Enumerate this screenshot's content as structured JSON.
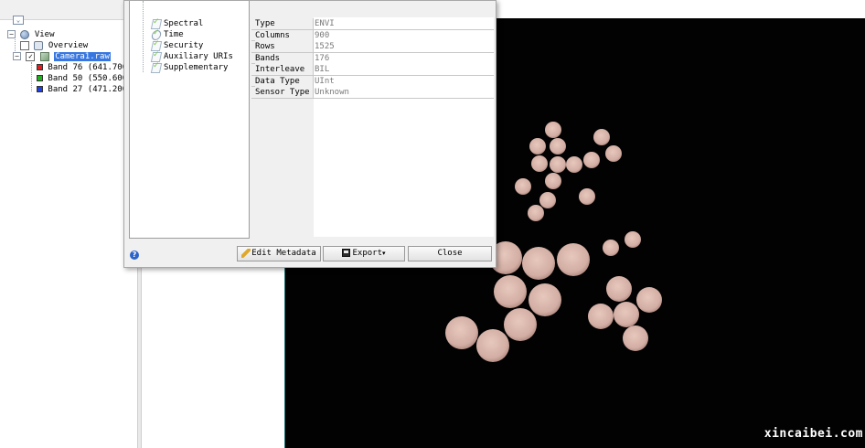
{
  "layer_manager": {
    "root_label": "View",
    "overview_label": "Overview",
    "file_label": "Camera1.raw",
    "bands": [
      {
        "label": "Band 76 (641.700",
        "color": "#e02020"
      },
      {
        "label": "Band 50 (550.600",
        "color": "#20b020"
      },
      {
        "label": "Band 27 (471.200",
        "color": "#2040e0"
      }
    ]
  },
  "metadata_dialog": {
    "categories": [
      {
        "label": "Spectral",
        "icon": "spectral-icon"
      },
      {
        "label": "Time",
        "icon": "clock-icon"
      },
      {
        "label": "Security",
        "icon": "check-icon"
      },
      {
        "label": "Auxiliary URIs",
        "icon": "check-icon"
      },
      {
        "label": "Supplementary",
        "icon": "check-icon"
      }
    ],
    "properties": [
      {
        "key": "Type",
        "value": "ENVI"
      },
      {
        "key": "Columns",
        "value": "900"
      },
      {
        "key": "Rows",
        "value": "1525"
      },
      {
        "key": "Bands",
        "value": "176"
      },
      {
        "key": "Interleave",
        "value": "BIL"
      },
      {
        "key": "Data Type",
        "value": "UInt"
      },
      {
        "key": "Sensor Type",
        "value": "Unknown"
      }
    ],
    "buttons": {
      "edit_metadata": "Edit Metadata",
      "export": "Export",
      "close": "Close"
    }
  },
  "image_view": {
    "watermark": "xincaibei.com",
    "background_color": "#020202",
    "sample_color": "#d8b4aa"
  }
}
